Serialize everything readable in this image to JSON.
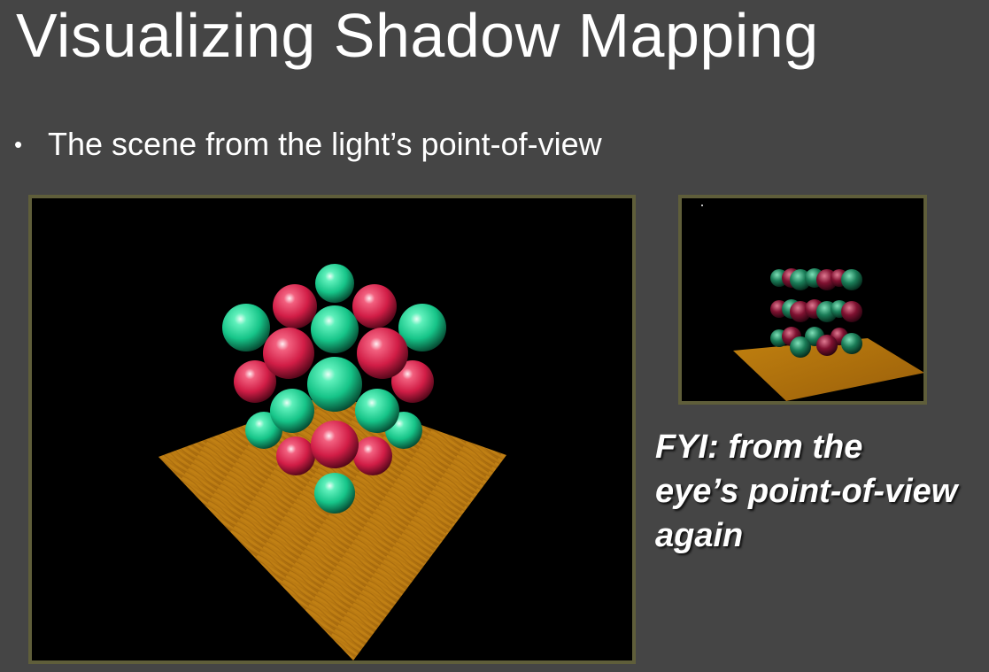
{
  "title": "Visualizing Shadow Mapping",
  "bullets": [
    {
      "icon": "bullet-dot",
      "text": "The scene from the light’s point-of-view"
    }
  ],
  "figures": {
    "light_view": {
      "content": "scene-render-light-view",
      "colors": {
        "green": "#1fc98a",
        "red": "#d21f45",
        "wood": "#b8780f"
      }
    },
    "eye_view": {
      "content": "scene-render-eye-view",
      "colors": {
        "green": "#1a7c57",
        "red": "#7e1130",
        "wood": "#b8780f"
      }
    }
  },
  "fyi": {
    "lines": [
      "FYI: from the",
      "eye’s point-of-view",
      "again"
    ]
  },
  "colors": {
    "background": "#454545",
    "frame_border": "#5f5e3a",
    "text": "#ffffff"
  }
}
